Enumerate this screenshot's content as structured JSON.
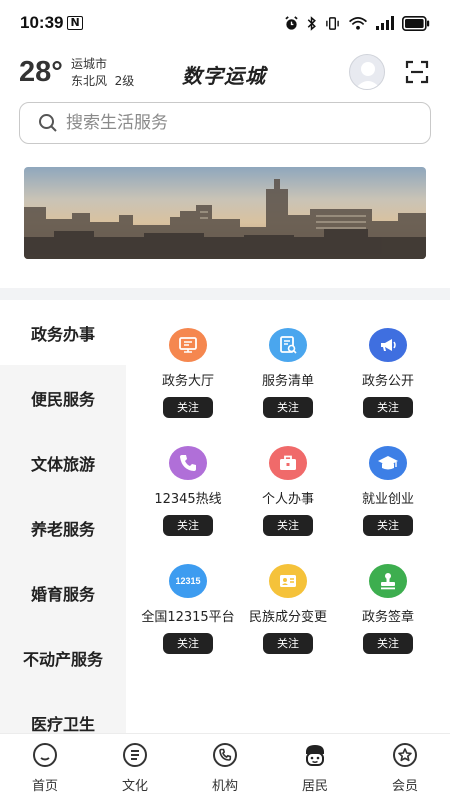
{
  "status": {
    "time": "10:39",
    "n_badge": "N"
  },
  "header": {
    "temperature": "28°",
    "city": "运城市",
    "wind": "东北风  2级",
    "app_title": "数字运城"
  },
  "search": {
    "placeholder": "搜索生活服务"
  },
  "categories": [
    {
      "label": "政务办事",
      "active": true
    },
    {
      "label": "便民服务",
      "active": false
    },
    {
      "label": "文体旅游",
      "active": false
    },
    {
      "label": "养老服务",
      "active": false
    },
    {
      "label": "婚育服务",
      "active": false
    },
    {
      "label": "不动产服务",
      "active": false
    },
    {
      "label": "医疗卫生",
      "active": false
    }
  ],
  "follow_label": "关注",
  "services": [
    {
      "label": "政务大厅",
      "icon": "hall-icon",
      "color": "#f5874f"
    },
    {
      "label": "服务清单",
      "icon": "list-search-icon",
      "color": "#4aa6ee"
    },
    {
      "label": "政务公开",
      "icon": "megaphone-icon",
      "color": "#3f6fe0"
    },
    {
      "label": "12345热线",
      "icon": "phone-icon",
      "color": "#b06fd8"
    },
    {
      "label": "个人办事",
      "icon": "briefcase-icon",
      "color": "#f06a6a"
    },
    {
      "label": "就业创业",
      "icon": "graduation-cap-icon",
      "color": "#3d7fe6"
    },
    {
      "label": "全国12315平台",
      "icon": "12315-icon",
      "icon_text": "12315",
      "color": "#3d9cf0"
    },
    {
      "label": "民族成分变更",
      "icon": "id-card-icon",
      "color": "#f5c23a"
    },
    {
      "label": "政务签章",
      "icon": "stamp-icon",
      "color": "#3dae4f"
    }
  ],
  "tabs": [
    {
      "label": "首页",
      "icon": "home-icon",
      "active": false
    },
    {
      "label": "文化",
      "icon": "culture-icon",
      "active": false
    },
    {
      "label": "机构",
      "icon": "phone-circle-icon",
      "active": false
    },
    {
      "label": "居民",
      "icon": "resident-icon",
      "active": true
    },
    {
      "label": "会员",
      "icon": "member-star-icon",
      "active": false
    }
  ]
}
